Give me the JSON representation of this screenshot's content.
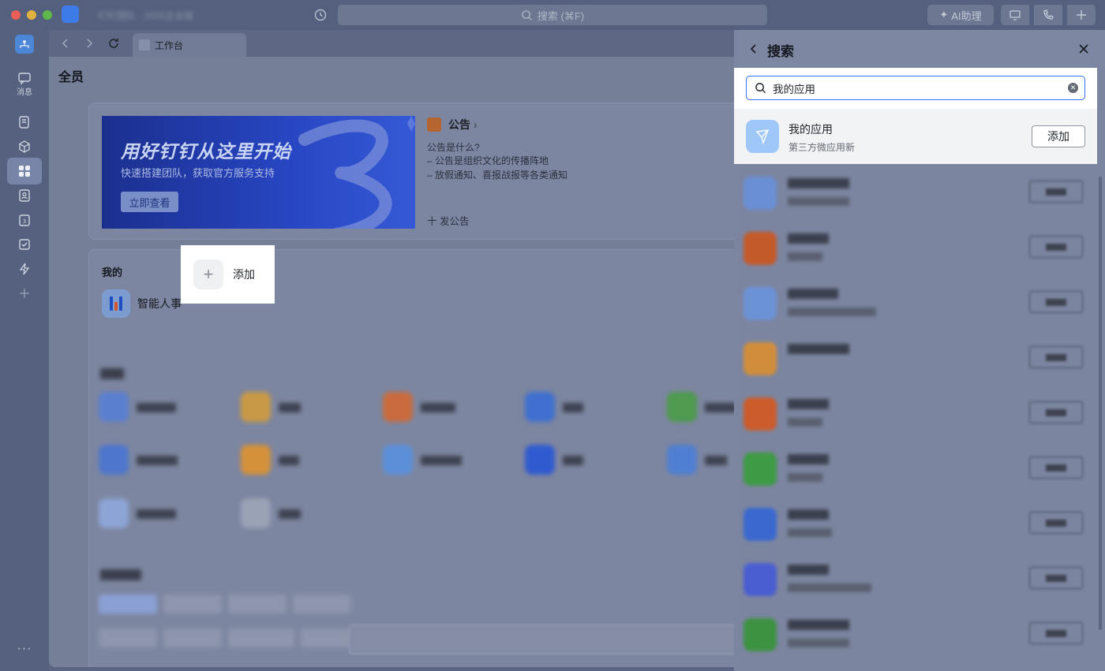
{
  "window": {
    "org_name": "钉钉团队 · 2025企业版",
    "search_placeholder": "搜索 (⌘F)",
    "ai_label": "AI助理"
  },
  "sidebar": {
    "messages_label": "消息"
  },
  "tabs": [
    {
      "label": "工作台"
    }
  ],
  "workbench": {
    "page_title": "全员",
    "banner": {
      "title": "用好钉钉从这里开始",
      "subtitle": "快速搭建团队，获取官方服务支持",
      "button": "立即查看"
    },
    "notice": {
      "title": "公告",
      "question": "公告是什么?",
      "lines": [
        "– 公告是组织文化的传播阵地",
        "– 放假通知、喜报战报等各类通知"
      ],
      "post": "十 发公告"
    },
    "my_section": {
      "title": "我的",
      "app_name": "智能人事",
      "add_label": "添加"
    }
  },
  "search_panel": {
    "title": "搜索",
    "query": "我的应用",
    "highlight_result": {
      "name": "我的应用",
      "subtitle": "第三方微应用新",
      "add_button": "添加"
    }
  },
  "colors": {
    "accent": "#3370ff",
    "hl_icon": "#9fc7f7"
  }
}
